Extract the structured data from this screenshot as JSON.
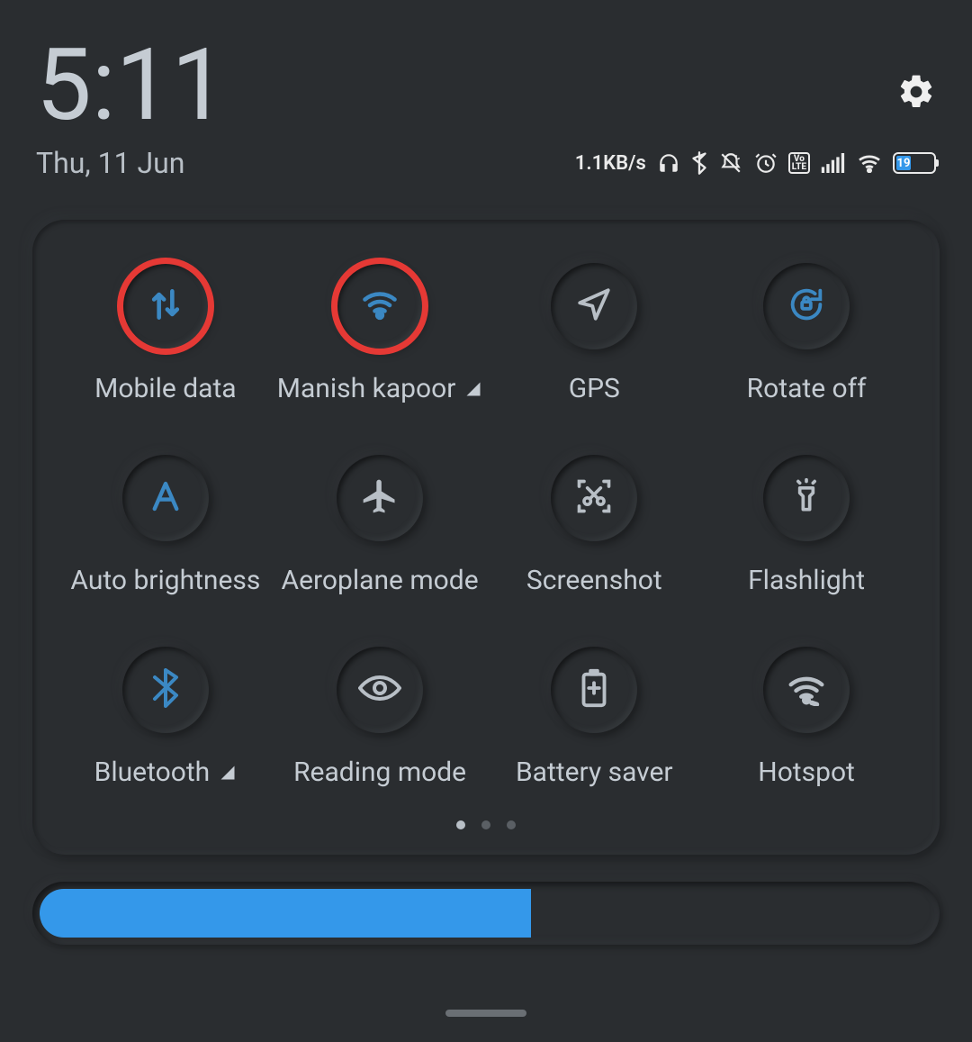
{
  "header": {
    "time": "5:11",
    "date": "Thu, 11 Jun",
    "network_speed": "1.1KB/s",
    "battery_percent": 19,
    "volte_label": "Vo\nLTE"
  },
  "tiles": [
    {
      "id": "mobile-data",
      "label": "Mobile data",
      "icon": "data-arrows",
      "active": true,
      "highlighted": true,
      "chevron": false
    },
    {
      "id": "wifi",
      "label": "Manish kapoor",
      "icon": "wifi",
      "active": true,
      "highlighted": true,
      "chevron": true
    },
    {
      "id": "gps",
      "label": "GPS",
      "icon": "location",
      "active": false,
      "highlighted": false,
      "chevron": false
    },
    {
      "id": "rotate",
      "label": "Rotate off",
      "icon": "rotate-lock",
      "active": true,
      "highlighted": false,
      "chevron": false
    },
    {
      "id": "auto-brightness",
      "label": "Auto brightness",
      "icon": "letter-a",
      "active": true,
      "highlighted": false,
      "chevron": false
    },
    {
      "id": "aeroplane",
      "label": "Aeroplane mode",
      "icon": "airplane",
      "active": false,
      "highlighted": false,
      "chevron": false
    },
    {
      "id": "screenshot",
      "label": "Screenshot",
      "icon": "scissors-box",
      "active": false,
      "highlighted": false,
      "chevron": false
    },
    {
      "id": "flashlight",
      "label": "Flashlight",
      "icon": "flashlight",
      "active": false,
      "highlighted": false,
      "chevron": false
    },
    {
      "id": "bluetooth",
      "label": "Bluetooth",
      "icon": "bluetooth",
      "active": true,
      "highlighted": false,
      "chevron": true
    },
    {
      "id": "reading",
      "label": "Reading mode",
      "icon": "eye",
      "active": false,
      "highlighted": false,
      "chevron": false
    },
    {
      "id": "battery-saver",
      "label": "Battery saver",
      "icon": "battery-plus",
      "active": false,
      "highlighted": false,
      "chevron": false
    },
    {
      "id": "hotspot",
      "label": "Hotspot",
      "icon": "hotspot",
      "active": false,
      "highlighted": false,
      "chevron": false
    }
  ],
  "pagination": {
    "pages": 3,
    "current": 0
  },
  "brightness_percent": 55
}
